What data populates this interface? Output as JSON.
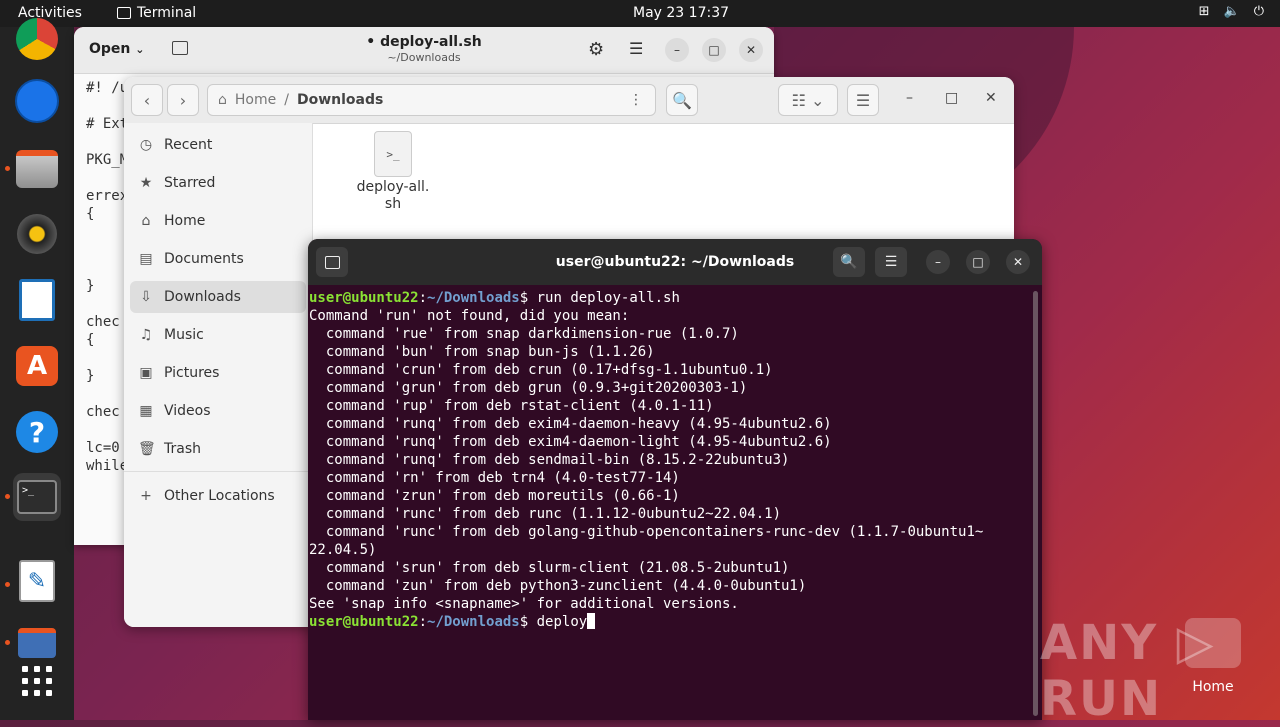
{
  "topbar": {
    "activities": "Activities",
    "app": "Terminal",
    "datetime": "May 23  17:37"
  },
  "editor": {
    "open_label": "Open",
    "title": "• deploy-all.sh",
    "subtitle": "~/Downloads",
    "code": "#! /u\n\n# Ext\n\nPKG_M\n\nerrex\n{\n\n\n\n}\n\nchec\n{\n\n}\n\nchec\n\nlc=0\nwhile"
  },
  "files": {
    "path_home": "Home",
    "path_sep": "/",
    "path_current": "Downloads",
    "sidebar": [
      {
        "label": "Recent",
        "icon": "clock-icon"
      },
      {
        "label": "Starred",
        "icon": "star-icon"
      },
      {
        "label": "Home",
        "icon": "home-icon"
      },
      {
        "label": "Documents",
        "icon": "document-icon"
      },
      {
        "label": "Downloads",
        "icon": "download-icon"
      },
      {
        "label": "Music",
        "icon": "music-icon"
      },
      {
        "label": "Pictures",
        "icon": "picture-icon"
      },
      {
        "label": "Videos",
        "icon": "video-icon"
      },
      {
        "label": "Trash",
        "icon": "trash-icon"
      },
      {
        "label": "Other Locations",
        "icon": "plus-icon"
      }
    ],
    "file": {
      "name": "deploy-all.\nsh",
      "glyph": ">_"
    }
  },
  "terminal": {
    "title": "user@ubuntu22: ~/Downloads",
    "prompt_user": "user@ubuntu22",
    "prompt_colon": ":",
    "prompt_path": "~/Downloads",
    "prompt_dollar": "$",
    "first_cmd": " run deploy-all.sh",
    "output": "Command 'run' not found, did you mean:\n  command 'rue' from snap darkdimension-rue (1.0.7)\n  command 'bun' from snap bun-js (1.1.26)\n  command 'crun' from deb crun (0.17+dfsg-1.1ubuntu0.1)\n  command 'grun' from deb grun (0.9.3+git20200303-1)\n  command 'rup' from deb rstat-client (4.0.1-11)\n  command 'runq' from deb exim4-daemon-heavy (4.95-4ubuntu2.6)\n  command 'runq' from deb exim4-daemon-light (4.95-4ubuntu2.6)\n  command 'runq' from deb sendmail-bin (8.15.2-22ubuntu3)\n  command 'rn' from deb trn4 (4.0-test77-14)\n  command 'zrun' from deb moreutils (0.66-1)\n  command 'runc' from deb runc (1.1.12-0ubuntu2~22.04.1)\n  command 'runc' from deb golang-github-opencontainers-runc-dev (1.1.7-0ubuntu1~\n22.04.5)\n  command 'srun' from deb slurm-client (21.08.5-2ubuntu1)\n  command 'zun' from deb python3-zunclient (4.4.0-0ubuntu1)\nSee 'snap info <snapname>' for additional versions.",
    "current_input": " deploy"
  },
  "desktop": {
    "watermark": "ANY ▷ RUN",
    "home_label": "Home"
  },
  "colors": {
    "terminal_bg": "#300a24",
    "prompt_user": "#8ae234",
    "prompt_path": "#729fcf",
    "accent": "#e95420"
  }
}
